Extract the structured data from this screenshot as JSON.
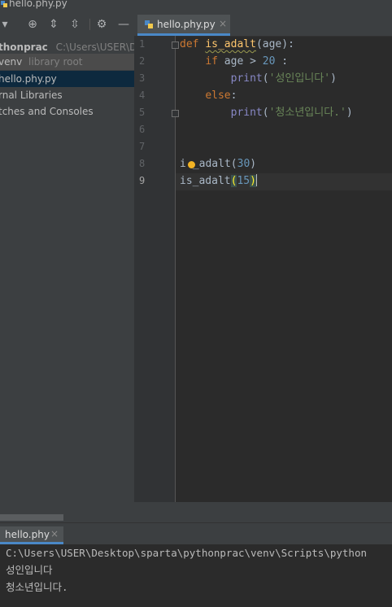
{
  "window": {
    "title": "hello.phy.py"
  },
  "project_panel": {
    "toolbar_icons": [
      "dropdown-arrow-icon",
      "locate-icon",
      "expand-all-icon",
      "collapse-all-icon",
      "gear-icon",
      "minimize-icon"
    ],
    "tree": [
      {
        "label": "thonprac",
        "detail": "C:\\Users\\USER\\Des"
      },
      {
        "label": "venv",
        "detail": "library root"
      },
      {
        "label": "hello.phy.py",
        "detail": ""
      },
      {
        "label": "rnal Libraries",
        "detail": ""
      },
      {
        "label": "tches and Consoles",
        "detail": ""
      }
    ]
  },
  "editor": {
    "tab": {
      "label": "hello.phy.py",
      "close": "×"
    },
    "line_numbers": [
      "1",
      "2",
      "3",
      "4",
      "5",
      "6",
      "7",
      "8",
      "9"
    ],
    "current_line": "9",
    "code": {
      "l1_kw": "def",
      "l1_fn": "is_adalt",
      "l1_rest": "(age):",
      "l2_kw": "if",
      "l2_a": " age > ",
      "l2_num": "20",
      "l2_b": " :",
      "l3_bi": "print",
      "l3_open": "(",
      "l3_str": "'성인입니다'",
      "l3_close": ")",
      "l4_kw": "else",
      "l4_rest": ":",
      "l5_bi": "print",
      "l5_open": "(",
      "l5_str": "'청소년입니다.'",
      "l5_close": ")",
      "l8_a": "i",
      "l8_b": "_adalt(",
      "l8_num": "30",
      "l8_c": ")",
      "l9_a": "is_adalt",
      "l9_open": "(",
      "l9_num": "15",
      "l9_close": ")"
    }
  },
  "run_panel": {
    "tab": {
      "label": "hello.phy",
      "close": "×"
    },
    "output": [
      "C:\\Users\\USER\\Desktop\\sparta\\pythonprac\\venv\\Scripts\\python",
      "성인입니다",
      "청소년입니다."
    ]
  },
  "colors": {
    "accent": "#4a88c7",
    "keyword": "#cc7832",
    "function": "#ffc66d",
    "number": "#6897bb",
    "string": "#6a8759",
    "builtin": "#8888c6"
  }
}
